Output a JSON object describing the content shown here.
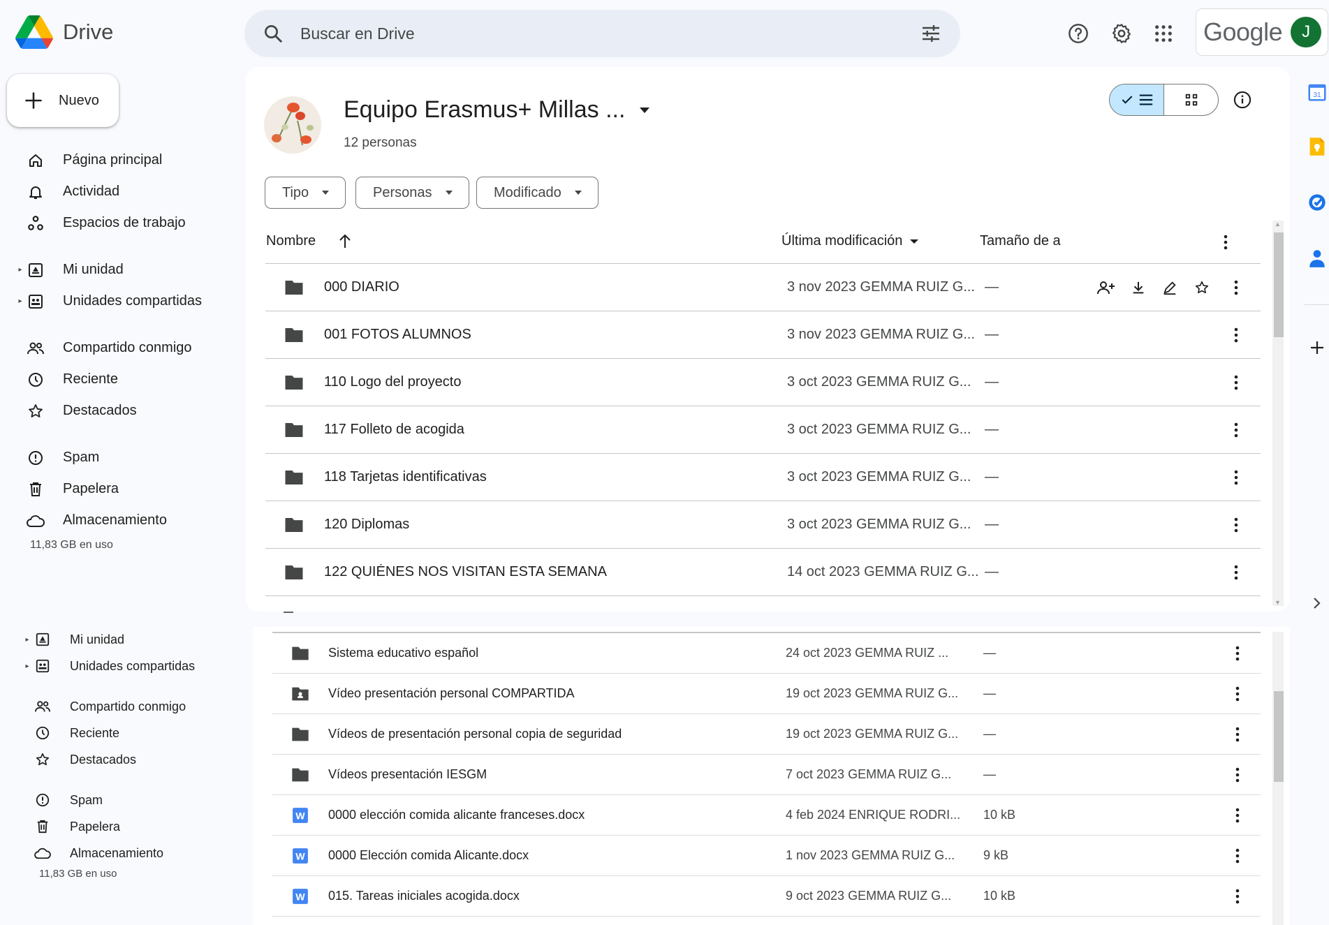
{
  "app": {
    "name": "Drive"
  },
  "search": {
    "placeholder": "Buscar en Drive"
  },
  "account": {
    "brand": "Google",
    "avatar_letter": "J"
  },
  "new_button": {
    "label": "Nuevo"
  },
  "sidebar": {
    "items": [
      {
        "label": "Página principal",
        "icon": "home-icon"
      },
      {
        "label": "Actividad",
        "icon": "bell-icon"
      },
      {
        "label": "Espacios de trabajo",
        "icon": "workspaces-icon"
      },
      {
        "label": "Mi unidad",
        "icon": "my-drive-icon"
      },
      {
        "label": "Unidades compartidas",
        "icon": "shared-drives-icon"
      },
      {
        "label": "Compartido conmigo",
        "icon": "people-icon"
      },
      {
        "label": "Reciente",
        "icon": "clock-icon"
      },
      {
        "label": "Destacados",
        "icon": "star-icon"
      },
      {
        "label": "Spam",
        "icon": "spam-icon"
      },
      {
        "label": "Papelera",
        "icon": "trash-icon"
      },
      {
        "label": "Almacenamiento",
        "icon": "cloud-icon"
      }
    ],
    "storage_used": "11,83 GB en uso"
  },
  "sidebar_duplicate": {
    "items": [
      {
        "label": "Mi unidad"
      },
      {
        "label": "Unidades compartidas"
      },
      {
        "label": "Compartido conmigo"
      },
      {
        "label": "Reciente"
      },
      {
        "label": "Destacados"
      },
      {
        "label": "Spam"
      },
      {
        "label": "Papelera"
      },
      {
        "label": "Almacenamiento"
      }
    ],
    "storage_used": "11,83 GB en uso"
  },
  "shared_drive": {
    "title": "Equipo Erasmus+ Millas ...",
    "members": "12 personas"
  },
  "filters": [
    {
      "label": "Tipo"
    },
    {
      "label": "Personas"
    },
    {
      "label": "Modificado"
    }
  ],
  "columns": {
    "name": "Nombre",
    "modified": "Última modificación",
    "size": "Tamaño de a"
  },
  "files_top": [
    {
      "name": "000 DIARIO",
      "modified": "3 nov 2023 GEMMA RUIZ G...",
      "size": "—",
      "type": "folder"
    },
    {
      "name": "001 FOTOS ALUMNOS",
      "modified": "3 nov 2023 GEMMA RUIZ G...",
      "size": "—",
      "type": "folder"
    },
    {
      "name": "110 Logo del proyecto",
      "modified": "3 oct 2023 GEMMA RUIZ G...",
      "size": "—",
      "type": "folder"
    },
    {
      "name": "117 Folleto de acogida",
      "modified": "3 oct 2023 GEMMA RUIZ G...",
      "size": "—",
      "type": "folder"
    },
    {
      "name": "118 Tarjetas identificativas",
      "modified": "3 oct 2023 GEMMA RUIZ G...",
      "size": "—",
      "type": "folder"
    },
    {
      "name": "120 Diplomas",
      "modified": "3 oct 2023 GEMMA RUIZ G...",
      "size": "—",
      "type": "folder"
    },
    {
      "name": "122 QUIÉNES NOS VISITAN ESTA SEMANA",
      "modified": "14 oct 2023 GEMMA RUIZ G...",
      "size": "—",
      "type": "folder"
    }
  ],
  "files_bottom": [
    {
      "name": "Sistema educativo español",
      "modified": "24 oct 2023 GEMMA RUIZ ...",
      "size": "—",
      "type": "folder"
    },
    {
      "name": "Vídeo presentación personal COMPARTIDA",
      "modified": "19 oct 2023 GEMMA RUIZ G...",
      "size": "—",
      "type": "shared-folder"
    },
    {
      "name": "Vídeos de presentación personal copia de seguridad",
      "modified": "19 oct 2023 GEMMA RUIZ G...",
      "size": "—",
      "type": "folder"
    },
    {
      "name": "Vídeos presentación IESGM",
      "modified": "7 oct 2023 GEMMA RUIZ G...",
      "size": "—",
      "type": "folder"
    },
    {
      "name": "0000 elección comida alicante franceses.docx",
      "modified": "4 feb 2024 ENRIQUE RODRI...",
      "size": "10 kB",
      "type": "word"
    },
    {
      "name": "0000 Elección comida Alicante.docx",
      "modified": "1 nov 2023 GEMMA RUIZ G...",
      "size": "9 kB",
      "type": "word"
    },
    {
      "name": "015. Tareas iniciales acogida.docx",
      "modified": "9 oct 2023 GEMMA RUIZ G...",
      "size": "10 kB",
      "type": "word"
    }
  ],
  "side_panel": {
    "apps": [
      "calendar-icon",
      "keep-icon",
      "tasks-icon",
      "contacts-icon"
    ],
    "calendar_day": "31"
  },
  "colors": {
    "accent_blue": "#0b57d0",
    "selected_toggle": "#c2e7ff",
    "word_blue": "#4285f4",
    "background": "#f8fafd"
  }
}
